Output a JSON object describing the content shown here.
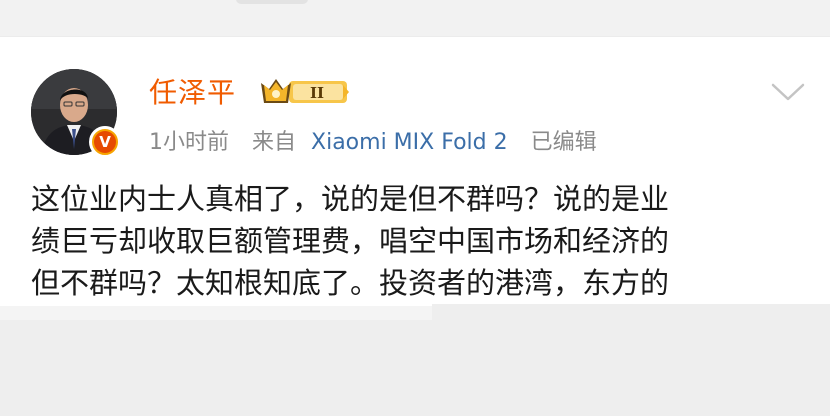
{
  "header": {
    "username": "任泽平",
    "rank_badge_text": "II",
    "verified_badge_text": "V"
  },
  "meta": {
    "time": "1小时前",
    "source_prefix": "来自",
    "device": "Xiaomi MIX Fold 2",
    "edited": "已编辑"
  },
  "post": {
    "lines": [
      "这位业内士人真相了，说的是但不群吗？说的是业",
      "绩巨亏却收取巨额管理费，唱空中国市场和经济的",
      "但不群吗？太知根知底了。投资者的港湾，东方的"
    ]
  },
  "colors": {
    "username": "#f05b00",
    "device_link": "#3b6ea8",
    "meta_text": "#8a8a8a",
    "post_text": "#1a1a1a",
    "badge_gold": "#f7a400"
  },
  "icons": {
    "dropdown": "chevron-down-icon",
    "crown": "crown-icon",
    "verified": "verified-badge-icon"
  }
}
